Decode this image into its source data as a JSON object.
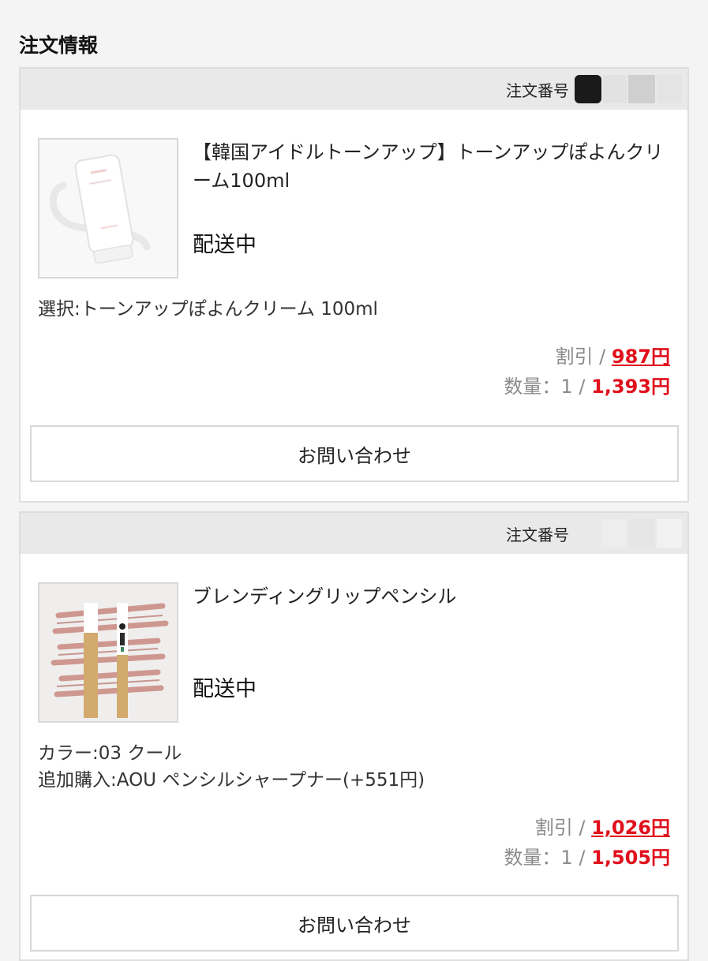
{
  "section_title": "注文情報",
  "order_label": "注文番号",
  "slash": "/",
  "orders": [
    {
      "product_name": "【韓国アイドルトーンアップ】トーンアップぽよんクリーム100ml",
      "status": "配送中",
      "options": [
        "選択:トーンアップぽよんクリーム 100ml"
      ],
      "discount_label": "割引",
      "discount_value": "987円",
      "quantity_label": "数量：1",
      "price": "1,393円",
      "inquiry_button": "お問い合わせ"
    },
    {
      "product_name": "ブレンディングリップペンシル",
      "status": "配送中",
      "options": [
        "カラー:03 クール",
        "追加購入:AOU ペンシルシャープナー(+551円)"
      ],
      "discount_label": "割引",
      "discount_value": "1,026円",
      "quantity_label": "数量：1",
      "price": "1,505円",
      "inquiry_button": "お問い合わせ"
    }
  ],
  "colors": {
    "price_red": "#e0101c",
    "header_gray": "#e9e9e9",
    "muted_text": "#8a8a8a"
  }
}
